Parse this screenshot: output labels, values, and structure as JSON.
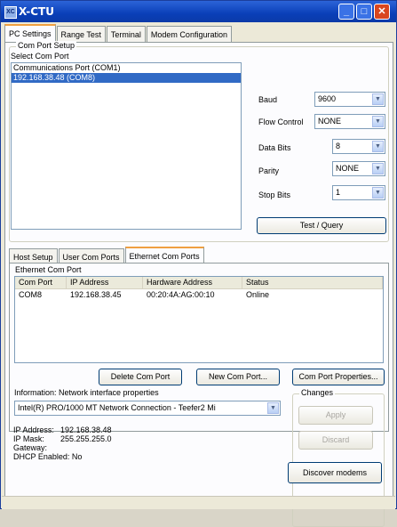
{
  "window": {
    "title": "X-CTU",
    "icon_text": "XC"
  },
  "tabs": [
    "PC Settings",
    "Range Test",
    "Terminal",
    "Modem Configuration"
  ],
  "com_port_setup": {
    "group_label": "Com Port Setup",
    "select_label": "Select Com Port",
    "ports": [
      "Communications Port (COM1)",
      "192.168.38.48 (COM8)"
    ],
    "selected_index": 1
  },
  "settings": {
    "baud_label": "Baud",
    "baud_value": "9600",
    "flow_label": "Flow Control",
    "flow_value": "NONE",
    "databits_label": "Data Bits",
    "databits_value": "8",
    "parity_label": "Parity",
    "parity_value": "NONE",
    "stopbits_label": "Stop Bits",
    "stopbits_value": "1",
    "test_button": "Test / Query"
  },
  "subtabs": [
    "Host Setup",
    "User Com Ports",
    "Ethernet Com Ports"
  ],
  "ethernet": {
    "group_label": "Ethernet Com Port",
    "columns": [
      "Com Port",
      "IP Address",
      "Hardware Address",
      "Status"
    ],
    "rows": [
      [
        "COM8",
        "192.168.38.45",
        "00:20:4A:AG:00:10",
        "Online"
      ]
    ],
    "delete_button": "Delete Com Port",
    "new_button": "New Com Port...",
    "properties_button": "Com Port Properties..."
  },
  "info": {
    "label": "Information: Network interface properties",
    "adapter": "Intel(R) PRO/1000 MT Network Connection - Teefer2 Mi",
    "ip_label": "IP Address:",
    "ip_value": "192.168.38.48",
    "mask_label": "IP Mask:",
    "mask_value": "255.255.255.0",
    "gateway_label": "Gateway:",
    "dhcp_label": "DHCP Enabled: No"
  },
  "changes": {
    "label": "Changes",
    "apply_button": "Apply",
    "discard_button": "Discard",
    "discover_button": "Discover modems"
  }
}
